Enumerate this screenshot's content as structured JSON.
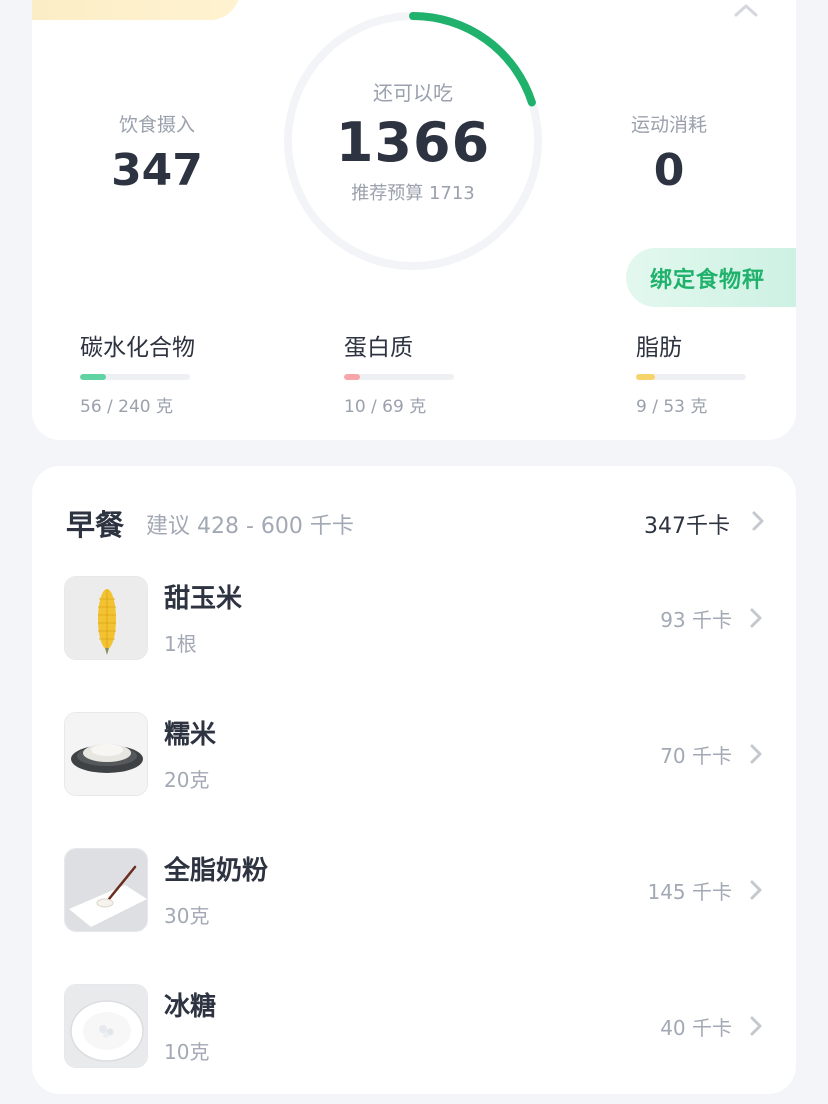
{
  "summary": {
    "intake": {
      "label": "饮食摄入",
      "value": "347"
    },
    "remaining": {
      "label": "还可以吃",
      "value": "1366",
      "budget": "推荐预算 1713",
      "progress": 0.2
    },
    "exercise": {
      "label": "运动消耗",
      "value": "0"
    },
    "bind_scale_label": "绑定食物秤",
    "macros": [
      {
        "name": "碳水化合物",
        "amount": "56 / 240 克",
        "fraction": 0.233,
        "color": "#5fd3a1"
      },
      {
        "name": "蛋白质",
        "amount": "10 / 69 克",
        "fraction": 0.145,
        "color": "#f7a5a8"
      },
      {
        "name": "脂肪",
        "amount": "9 / 53 克",
        "fraction": 0.17,
        "color": "#f7d46a"
      }
    ]
  },
  "meal": {
    "title": "早餐",
    "suggestion": "建议 428 - 600 千卡",
    "total": "347千卡",
    "items": [
      {
        "name": "甜玉米",
        "qty": "1根",
        "kcal": "93 千卡"
      },
      {
        "name": "糯米",
        "qty": "20克",
        "kcal": "70 千卡"
      },
      {
        "name": "全脂奶粉",
        "qty": "30克",
        "kcal": "145 千卡"
      },
      {
        "name": "冰糖",
        "qty": "10克",
        "kcal": "40 千卡"
      }
    ]
  },
  "colors": {
    "ring_progress": "#20b26c",
    "ring_track": "#f2f4f8",
    "accent_green": "#20b26c"
  }
}
